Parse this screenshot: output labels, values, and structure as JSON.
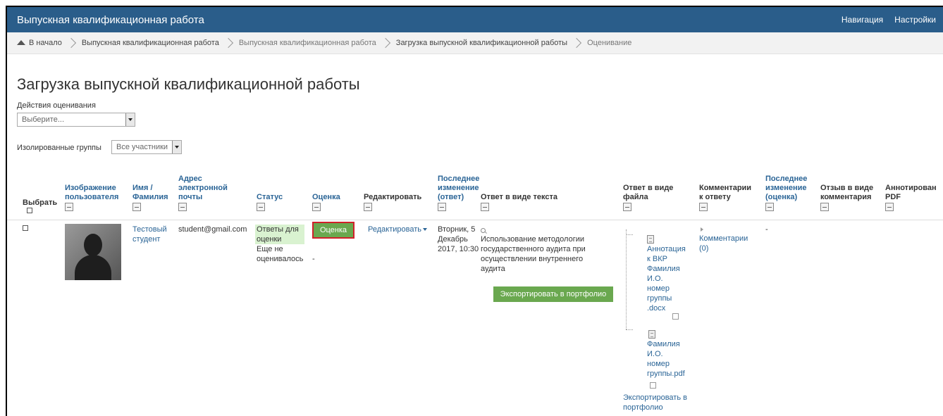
{
  "header": {
    "title": "Выпускная квалификационная работа",
    "nav": "Навигация",
    "settings": "Настройки"
  },
  "breadcrumb": [
    "В начало",
    "Выпускная квалификационная работа",
    "Выпускная квалификационная работа",
    "Загрузка выпускной квалификационной работы",
    "Оценивание"
  ],
  "page": {
    "title": "Загрузка выпускной квалификационной работы",
    "actions_label": "Действия оценивания",
    "actions_select": "Выберите...",
    "groups_label": "Изолированные группы",
    "groups_select": "Все участники"
  },
  "columns": {
    "select": "Выбрать",
    "image_1": "Изображение",
    "image_2": "пользователя",
    "name_1": "Имя /",
    "name_2": "Фамилия",
    "email_1": "Адрес",
    "email_2": "электронной",
    "email_3": "почты",
    "status": "Статус",
    "grade": "Оценка",
    "edit": "Редактировать",
    "modified_1": "Последнее",
    "modified_2": "изменение",
    "modified_3": "(ответ)",
    "text_answer": "Ответ в виде текста",
    "file_answer_1": "Ответ в виде",
    "file_answer_2": "файла",
    "comments_1": "Комментарии",
    "comments_2": "к ответу",
    "grade_mod_1": "Последнее",
    "grade_mod_2": "изменение",
    "grade_mod_3": "(оценка)",
    "feedback_1": "Отзыв в виде",
    "feedback_2": "комментария",
    "annot_1": "Аннотирован",
    "annot_2": "PDF"
  },
  "row": {
    "name_1": "Тестовый",
    "name_2": "студент",
    "email": "student@gmail.com",
    "status_1": "Ответы для",
    "status_2": "оценки",
    "status_3": "Еще не",
    "status_4": "оценивалось",
    "grade_dash": "-",
    "grade_button": "Оценка",
    "edit_link": "Редактировать",
    "modified_1": "Вторник, 5",
    "modified_2": "Декабрь",
    "modified_3": "2017, 10:30",
    "text_1": "Использование методологии",
    "text_2": "государственного аудита при",
    "text_3": "осуществлении внутреннего",
    "text_4": "аудита",
    "export_text": "Экспортировать в портфолио",
    "file1": [
      "Аннотация",
      "к ВКР",
      "Фамилия",
      "И.О.",
      "номер",
      "группы",
      ".docx"
    ],
    "file2": [
      "Фамилия",
      "И.О.",
      "номер",
      "группы.pdf"
    ],
    "export_files_1": "Экспортировать в",
    "export_files_2": "портфолио",
    "comments_1": "Комментарии",
    "comments_2": "(0)",
    "grade_mod": "-"
  },
  "colors": {
    "topbar": "#2a5d8a",
    "link": "#2a6496",
    "button_green": "#6aa84f",
    "highlight_border": "#d0202a"
  }
}
